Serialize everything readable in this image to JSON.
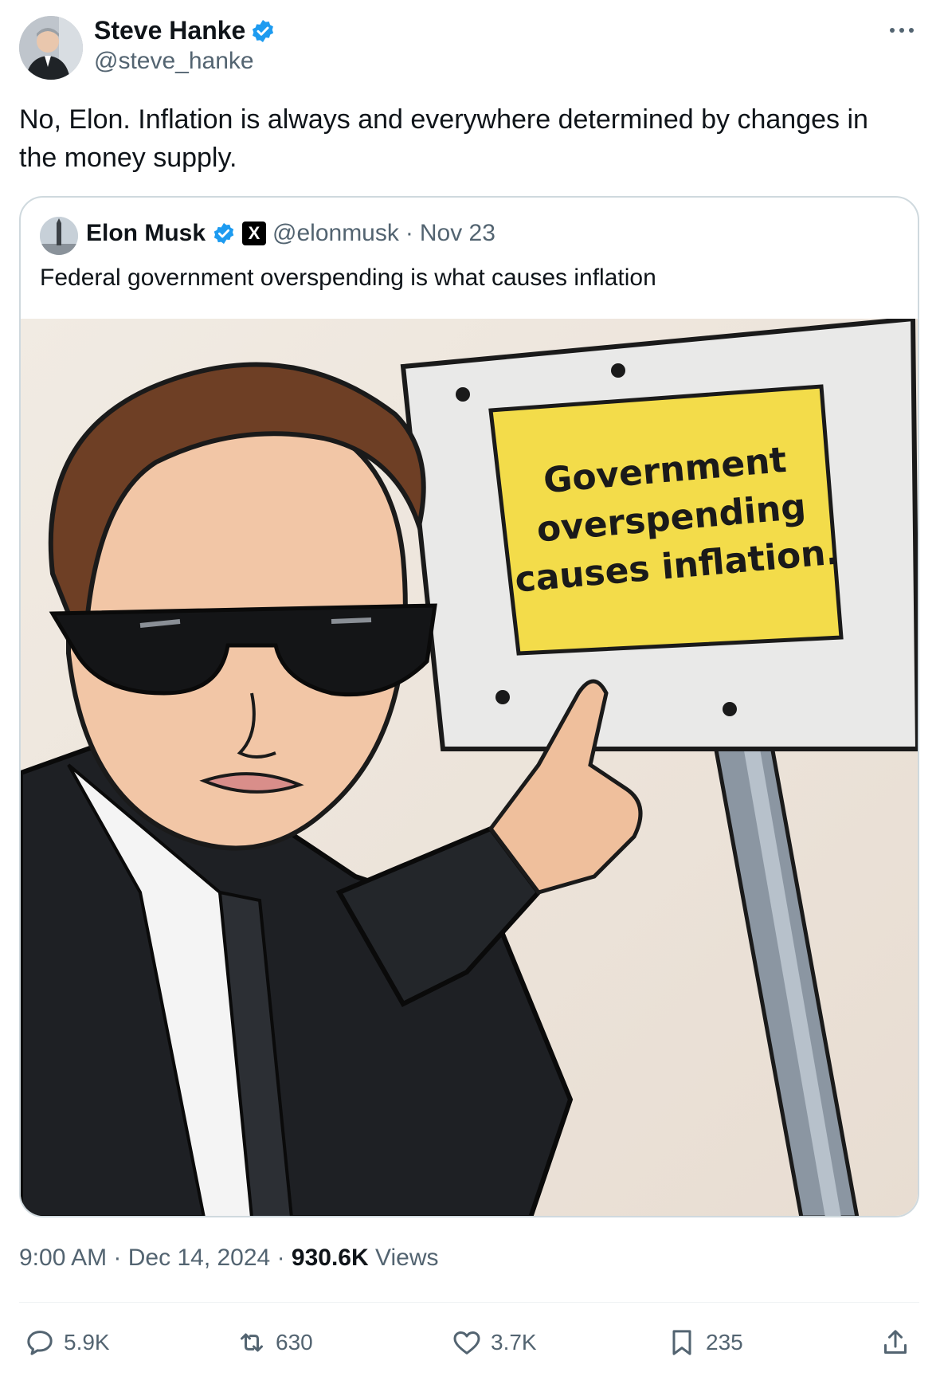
{
  "author": {
    "name": "Steve Hanke",
    "handle": "@steve_hanke",
    "verified_color": "#1d9bf0"
  },
  "tweet": {
    "text": "No, Elon. Inflation is always and everywhere determined by changes in the money supply."
  },
  "quoted": {
    "name": "Elon Musk",
    "affiliation_badge": "X",
    "handle": "@elonmusk",
    "separator": "·",
    "date": "Nov 23",
    "text": "Federal government overspending is what causes inflation",
    "sign_text": [
      "Government",
      "overspending",
      "causes inflation."
    ]
  },
  "meta": {
    "time": "9:00 AM",
    "sep1": "·",
    "date": "Dec 14, 2024",
    "sep2": "·",
    "views_count": "930.6K",
    "views_label": "Views"
  },
  "actions": {
    "replies": "5.9K",
    "reposts": "630",
    "likes": "3.7K",
    "bookmarks": "235"
  },
  "icons": {
    "more": "more-icon",
    "verified": "verified-badge-icon",
    "reply": "reply-icon",
    "repost": "repost-icon",
    "like": "like-icon",
    "bookmark": "bookmark-icon",
    "share": "share-icon"
  }
}
